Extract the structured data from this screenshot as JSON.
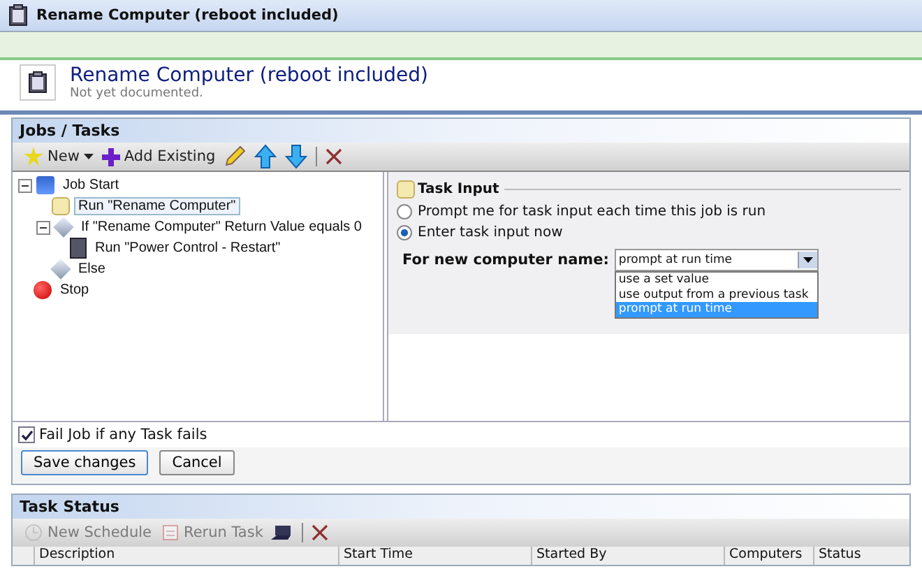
{
  "window": {
    "title": "Rename Computer (reboot included)"
  },
  "header": {
    "title": "Rename Computer (reboot included)",
    "subtitle": "Not yet documented."
  },
  "jobs_panel": {
    "title": "Jobs / Tasks",
    "toolbar": [
      {
        "kind": "new",
        "label": "New",
        "disabled": false
      },
      {
        "kind": "add",
        "label": "Add Existing",
        "disabled": false
      },
      {
        "kind": "edit",
        "disabled": false
      },
      {
        "kind": "up",
        "disabled": false
      },
      {
        "kind": "down",
        "disabled": false
      },
      {
        "kind": "delete",
        "disabled": false
      }
    ],
    "tree": [
      {
        "label": "Job Start",
        "kind": "start",
        "expanded": true,
        "selected": false,
        "children": [
          {
            "label": "Run \"Rename Computer\"",
            "kind": "script",
            "selected": true
          },
          {
            "label": "If \"Rename Computer\" Return Value equals 0",
            "kind": "condition",
            "expanded": true,
            "selected": false,
            "children": [
              {
                "label": "Run \"Power Control - Restart\"",
                "kind": "task",
                "selected": false
              }
            ]
          },
          {
            "label": "Else",
            "kind": "condition",
            "selected": false
          }
        ]
      },
      {
        "label": "Stop",
        "kind": "stop",
        "selected": false
      }
    ],
    "task_input": {
      "title": "Task Input",
      "options": [
        {
          "label": "Prompt me for task input each time this job is run",
          "selected": false
        },
        {
          "label": "Enter task input now",
          "selected": true
        }
      ],
      "field_label": "For new computer name:",
      "value": "prompt at run time",
      "dropdown": [
        {
          "label": "use a set value",
          "selected": false
        },
        {
          "label": "use output from a previous task",
          "selected": false
        },
        {
          "label": "prompt at run time",
          "selected": true
        }
      ]
    },
    "fail_job": {
      "label": "Fail Job if any Task fails",
      "checked": true
    },
    "buttons": [
      {
        "label": "Save changes",
        "primary": true
      },
      {
        "label": "Cancel",
        "primary": false
      }
    ]
  },
  "status_panel": {
    "title": "Task Status",
    "toolbar": [
      {
        "kind": "schedule",
        "label": "New Schedule",
        "disabled": true
      },
      {
        "kind": "rerun",
        "label": "Rerun Task",
        "disabled": true
      },
      {
        "kind": "computer",
        "disabled": false
      },
      {
        "kind": "delete",
        "disabled": false
      }
    ],
    "columns": [
      "Description",
      "Start Time",
      "Started By",
      "Computers",
      "Status"
    ]
  }
}
